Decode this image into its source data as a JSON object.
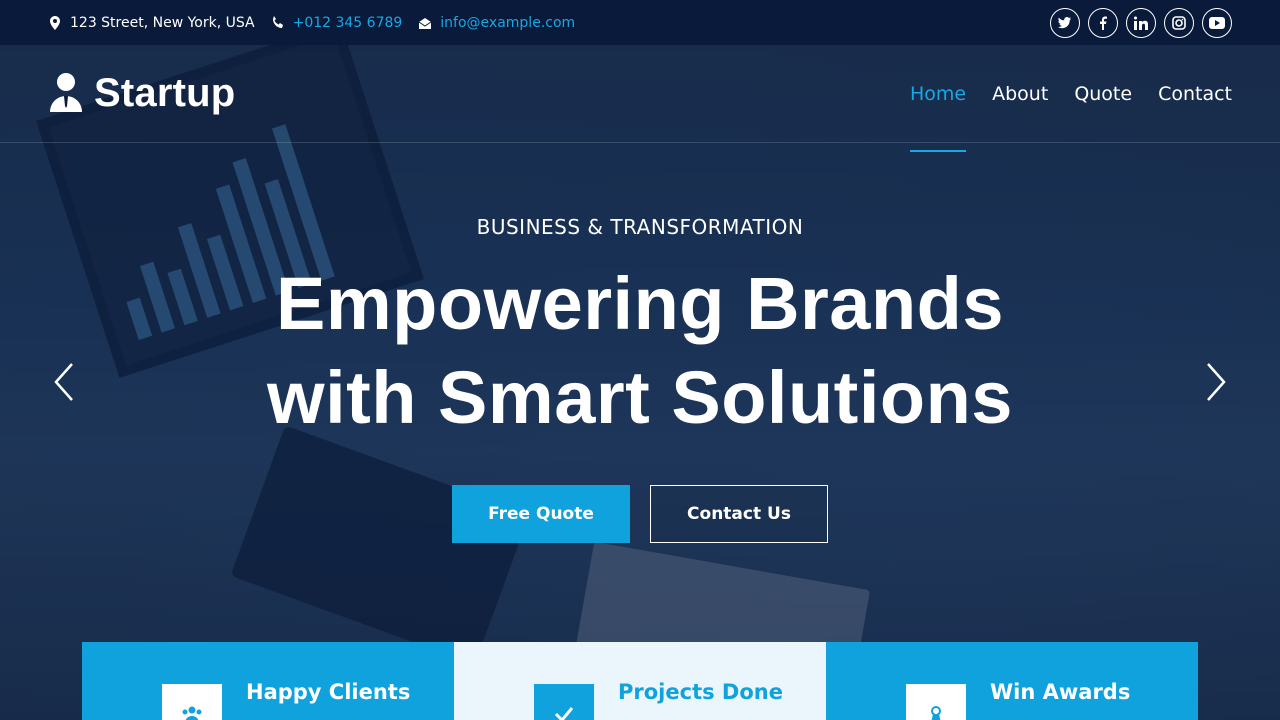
{
  "topbar": {
    "address": "123 Street, New York, USA",
    "phone": "+012 345 6789",
    "email": "info@example.com",
    "social": [
      "twitter-icon",
      "facebook-icon",
      "linkedin-icon",
      "instagram-icon",
      "youtube-icon"
    ]
  },
  "brand": {
    "name": "Startup"
  },
  "nav": {
    "items": [
      "Home",
      "About",
      "Quote",
      "Contact"
    ],
    "active": "Home"
  },
  "hero": {
    "kicker": "BUSINESS & TRANSFORMATION",
    "headline_line1": "Empowering Brands",
    "headline_line2": "with Smart Solutions",
    "primary_button": "Free Quote",
    "secondary_button": "Contact Us"
  },
  "stats": [
    {
      "label": "Happy Clients",
      "icon": "users-icon"
    },
    {
      "label": "Projects Done",
      "icon": "check-icon"
    },
    {
      "label": "Win Awards",
      "icon": "award-icon"
    }
  ],
  "colors": {
    "accent": "#0fa2dd",
    "topbar": "#0a1a3a",
    "light_card": "#eaf6fb"
  }
}
